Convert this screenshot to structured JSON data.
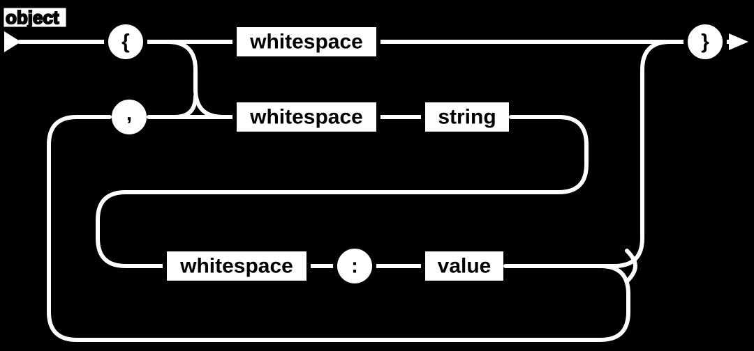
{
  "diagram": {
    "title": "object",
    "terminals": {
      "open_brace": "{",
      "close_brace": "}",
      "comma": ",",
      "colon": ":"
    },
    "nonterminals": {
      "whitespace1": "whitespace",
      "whitespace2": "whitespace",
      "whitespace3": "whitespace",
      "string": "string",
      "value": "value"
    }
  }
}
